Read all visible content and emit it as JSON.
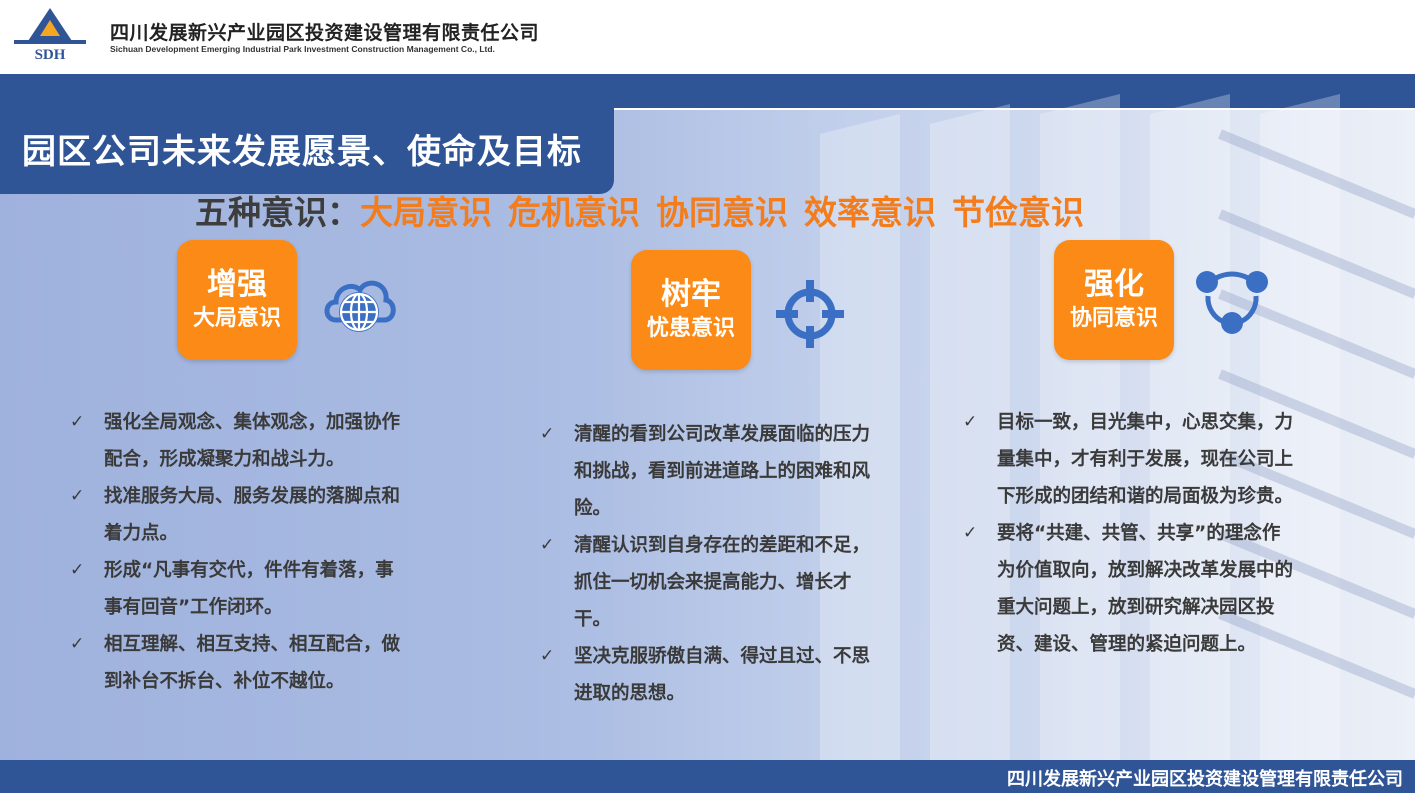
{
  "header": {
    "logo_text": "SDH",
    "company_cn": "四川发展新兴产业园区投资建设管理有限责任公司",
    "company_en": "Sichuan Development Emerging Industrial Park Investment Construction Management Co., Ltd."
  },
  "title": "园区公司未来发展愿景、使命及目标",
  "subtitle": {
    "lead": "五种意识：",
    "tags": [
      "大局意识",
      "危机意识",
      "协同意识",
      "效率意识",
      "节俭意识"
    ]
  },
  "columns": [
    {
      "badge_line1": "增强",
      "badge_line2": "大局意识",
      "icon": "globe-cloud-icon",
      "bullets": [
        "强化全局观念、集体观念，加强协作配合，形成凝聚力和战斗力。",
        "找准服务大局、服务发展的落脚点和着力点。",
        "形成“凡事有交代，件件有着落，事事有回音”工作闭环。",
        "相互理解、相互支持、相互配合，做到补台不拆台、补位不越位。"
      ]
    },
    {
      "badge_line1": "树牢",
      "badge_line2": "忧患意识",
      "icon": "target-icon",
      "bullets": [
        "清醒的看到公司改革发展面临的压力和挑战，看到前进道路上的困难和风险。",
        "清醒认识到自身存在的差距和不足，抓住一切机会来提高能力、增长才干。",
        "坚决克服骄傲自满、得过且过、不思进取的思想。"
      ]
    },
    {
      "badge_line1": "强化",
      "badge_line2": "协同意识",
      "icon": "network-icon",
      "bullets": [
        "目标一致，目光集中，心思交集，力量集中，才有利于发展，现在公司上下形成的团结和谐的局面极为珍贵。",
        "要将“共建、共管、共享”的理念作为价值取向，放到解决改革发展中的重大问题上，放到研究解决园区投资、建设、管理的紧迫问题上。"
      ]
    }
  ],
  "check_mark": "✓",
  "footer": {
    "text": "四川发展新兴产业园区投资建设管理有限责任公司"
  },
  "colors": {
    "accent_orange": "#fb8a16",
    "subtitle_orange": "#f37c1c",
    "brand_blue": "#2f5597",
    "icon_blue": "#3a6fc4"
  }
}
